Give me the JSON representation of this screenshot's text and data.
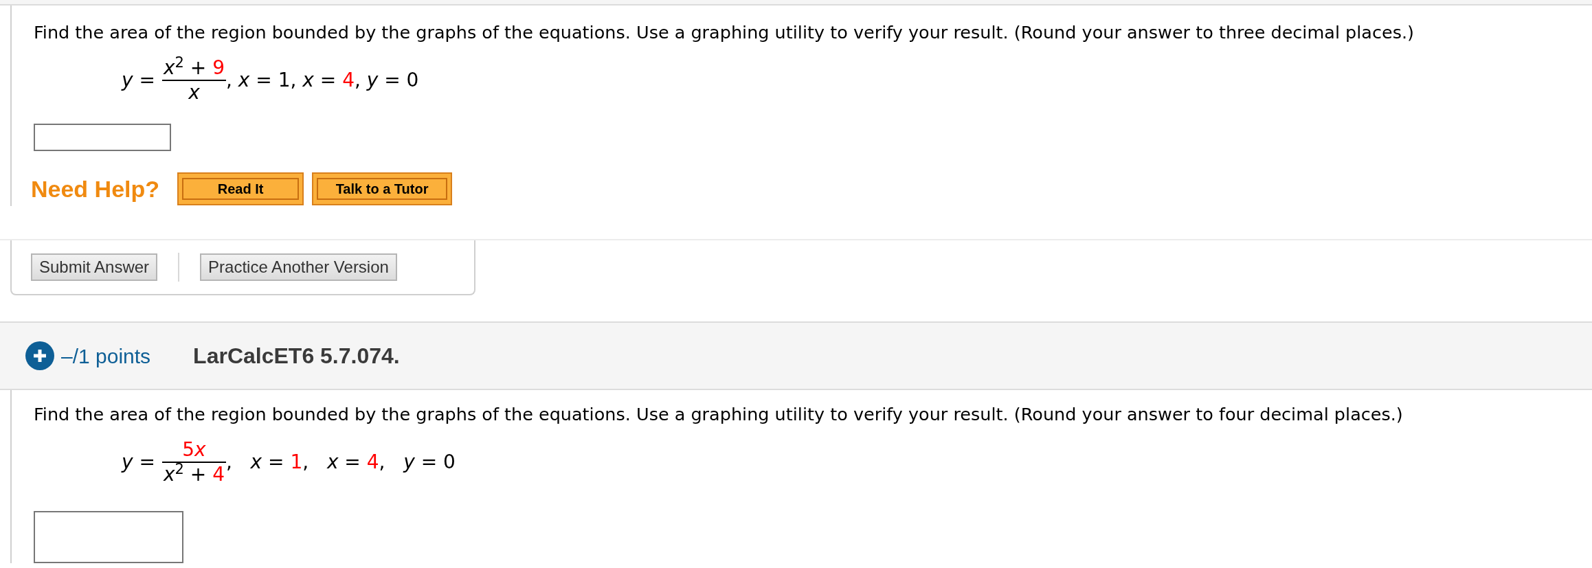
{
  "questions": [
    {
      "prompt": "Find the area of the region bounded by the graphs of the equations. Use a graphing utility to verify your result. (Round your answer to three decimal places.)",
      "equation": {
        "lhs": "*y* =",
        "numerator": [
          {
            "text": "*x*$^{2}$ + ",
            "highlight": false
          },
          {
            "text": "9",
            "highlight": true
          }
        ],
        "denominator": [
          {
            "text": "*x*",
            "highlight": false
          }
        ],
        "rest": [
          {
            "text": ", *x* = 1, *x* = ",
            "highlight": false
          },
          {
            "text": "4",
            "highlight": true
          },
          {
            "text": ", *y* = 0",
            "highlight": false
          }
        ]
      },
      "help": {
        "label": "Need Help?",
        "buttons": [
          "Read It",
          "Talk to a Tutor"
        ]
      },
      "actions": [
        "Submit Answer",
        "Practice Another Version"
      ]
    },
    {
      "header": {
        "points": "–/1 points",
        "title": "LarCalcET6 5.7.074."
      },
      "prompt": "Find the area of the region bounded by the graphs of the equations. Use a graphing utility to verify your result. (Round your answer to four decimal places.)",
      "equation": {
        "lhs": "*y* =",
        "numerator": [
          {
            "text": "5",
            "highlight": true
          },
          {
            "text": "*x*",
            "highlight": true
          }
        ],
        "denominator": [
          {
            "text": "*x*$^{2}$ + ",
            "highlight": false
          },
          {
            "text": "4",
            "highlight": true
          }
        ],
        "rest": [
          {
            "text": ",   *x* = ",
            "highlight": false
          },
          {
            "text": "1",
            "highlight": true
          },
          {
            "text": ",   *x* = ",
            "highlight": false
          },
          {
            "text": "4",
            "highlight": true
          },
          {
            "text": ",   *y* = 0",
            "highlight": false
          }
        ]
      }
    }
  ]
}
